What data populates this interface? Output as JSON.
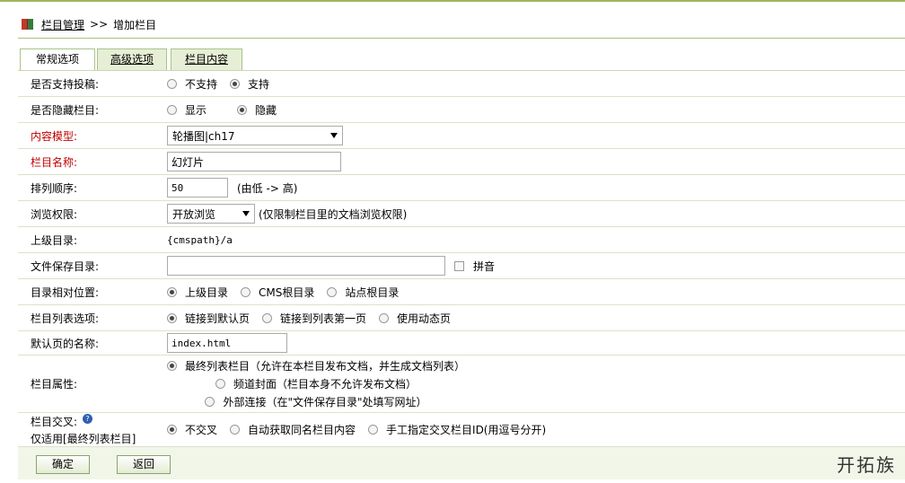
{
  "breadcrumb": {
    "link": "栏目管理",
    "sep": ">>",
    "current": "增加栏目"
  },
  "tabs": [
    {
      "label": "常规选项",
      "active": true
    },
    {
      "label": "高级选项",
      "active": false
    },
    {
      "label": "栏目内容",
      "active": false
    }
  ],
  "form": {
    "allow_submit": {
      "label": "是否支持投稿:",
      "options": [
        "不支持",
        "支持"
      ],
      "selected": 1
    },
    "hide_column": {
      "label": "是否隐藏栏目:",
      "options": [
        "显示",
        "隐藏"
      ],
      "selected": 1
    },
    "content_model": {
      "label": "内容模型:",
      "value": "轮播图|ch17"
    },
    "column_name": {
      "label": "栏目名称:",
      "value": "幻灯片"
    },
    "sort_order": {
      "label": "排列顺序:",
      "value": "50",
      "hint": "(由低 -> 高)"
    },
    "browse_perm": {
      "label": "浏览权限:",
      "value": "开放浏览",
      "hint": "(仅限制栏目里的文档浏览权限)"
    },
    "parent_dir": {
      "label": "上级目录:",
      "value": "{cmspath}/a"
    },
    "save_dir": {
      "label": "文件保存目录:",
      "value": "",
      "pinyin": "拼音"
    },
    "dir_position": {
      "label": "目录相对位置:",
      "options": [
        "上级目录",
        "CMS根目录",
        "站点根目录"
      ],
      "selected": 0
    },
    "list_option": {
      "label": "栏目列表选项:",
      "options": [
        "链接到默认页",
        "链接到列表第一页",
        "使用动态页"
      ],
      "selected": 0
    },
    "default_page": {
      "label": "默认页的名称:",
      "value": "index.html"
    },
    "column_attr": {
      "label": "栏目属性:",
      "options": [
        "最终列表栏目（允许在本栏目发布文档，并生成文档列表）",
        "频道封面（栏目本身不允许发布文档）",
        "外部连接（在\"文件保存目录\"处填写网址）"
      ],
      "selected": 0
    },
    "cross": {
      "label": "栏目交叉:",
      "sublabel": "仅适用[最终列表栏目]",
      "help_icon": "question-icon",
      "options": [
        "不交叉",
        "自动获取同名栏目内容",
        "手工指定交叉栏目ID(用逗号分开)"
      ],
      "selected": 0
    }
  },
  "footer": {
    "ok": "确定",
    "back": "返回",
    "brand": "开拓族"
  },
  "colors": {
    "accent": "#9fb65b",
    "required_label": "#c00000"
  }
}
